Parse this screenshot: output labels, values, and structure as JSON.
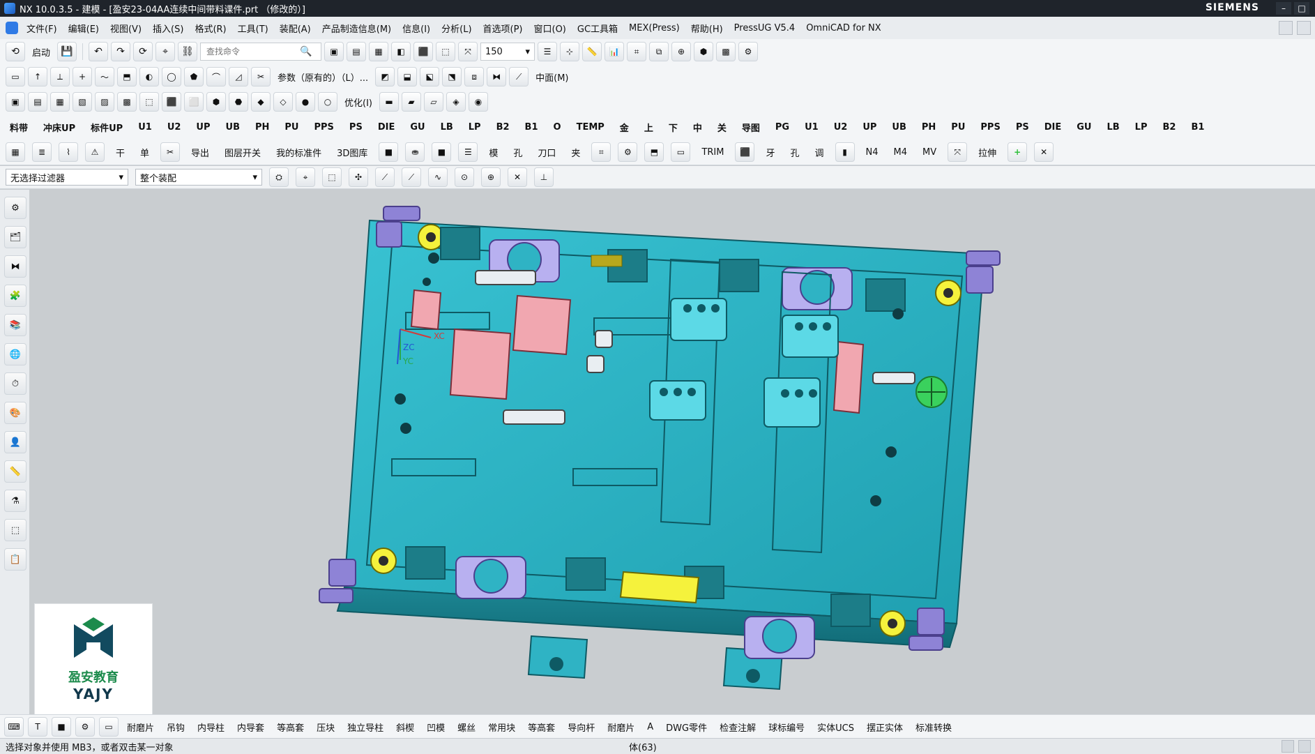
{
  "window": {
    "title": "NX 10.0.3.5 - 建模 - [盈安23-04AA连续中间带料课件.prt （修改的）]",
    "brand": "SIEMENS"
  },
  "menu": {
    "items": [
      "文件(F)",
      "编辑(E)",
      "视图(V)",
      "插入(S)",
      "格式(R)",
      "工具(T)",
      "装配(A)",
      "产品制造信息(M)",
      "信息(I)",
      "分析(L)",
      "首选项(P)",
      "窗口(O)",
      "GC工具箱",
      "MEX(Press)",
      "帮助(H)",
      "PressUG V5.4",
      "OmniCAD for NX"
    ]
  },
  "toolbar1": {
    "start_label": "启动",
    "search_placeholder": "查找命令",
    "zoom_value": "150"
  },
  "toolbar2": {
    "params_label": "参数（原有的）（L）...",
    "layer_label": "中面(M)"
  },
  "toolbar3": {
    "optimize_label": "优化(I)"
  },
  "toolbar4": {
    "labels": [
      "料带",
      "冲床UP",
      "标件UP",
      "U1",
      "U2",
      "UP",
      "UB",
      "PH",
      "PU",
      "PPS",
      "PS",
      "DIE",
      "GU",
      "LB",
      "LP",
      "B2",
      "B1",
      "O",
      "TEMP",
      "金",
      "上",
      "下",
      "中",
      "关",
      "导图",
      "PG",
      "U1",
      "U2",
      "UP",
      "UB",
      "PH",
      "PU",
      "PPS",
      "PS",
      "DIE",
      "GU",
      "LB",
      "LP",
      "B2",
      "B1"
    ]
  },
  "toolbar5": {
    "labels": [
      "干",
      "单",
      "导出",
      "图层开关",
      "我的标准件",
      "3D图库",
      "模",
      "孔",
      "刀口",
      "夹",
      "TRIM",
      "牙",
      "孔",
      "调",
      "N4",
      "M4",
      "MV",
      "拉伸"
    ]
  },
  "selector": {
    "filter": "无选择过滤器",
    "scope": "整个装配"
  },
  "viewport": {
    "axes": [
      "ZC",
      "YC",
      "XC"
    ]
  },
  "watermark": {
    "cn": "盈安教育",
    "en": "YAJY"
  },
  "bottom_toolbar": {
    "labels": [
      "耐磨片",
      "吊钩",
      "内导柱",
      "内导套",
      "等高套",
      "压块",
      "独立导柱",
      "斜楔",
      "凹模",
      "螺丝",
      "常用块",
      "等高套",
      "导向杆",
      "耐磨片",
      "A",
      "DWG零件",
      "检查注解",
      "球标编号",
      "实体UCS",
      "摆正实体",
      "标准转换"
    ]
  },
  "status": {
    "message": "选择对象并使用 MB3，或者双击某一对象",
    "center": "体(63)"
  },
  "colors": {
    "plate": "#2fb3c4",
    "plate_dark": "#1d8a98",
    "guide": "#8e83d6",
    "pink": "#f1a7b0",
    "yellow": "#f5f23c",
    "green": "#3ad15d"
  }
}
